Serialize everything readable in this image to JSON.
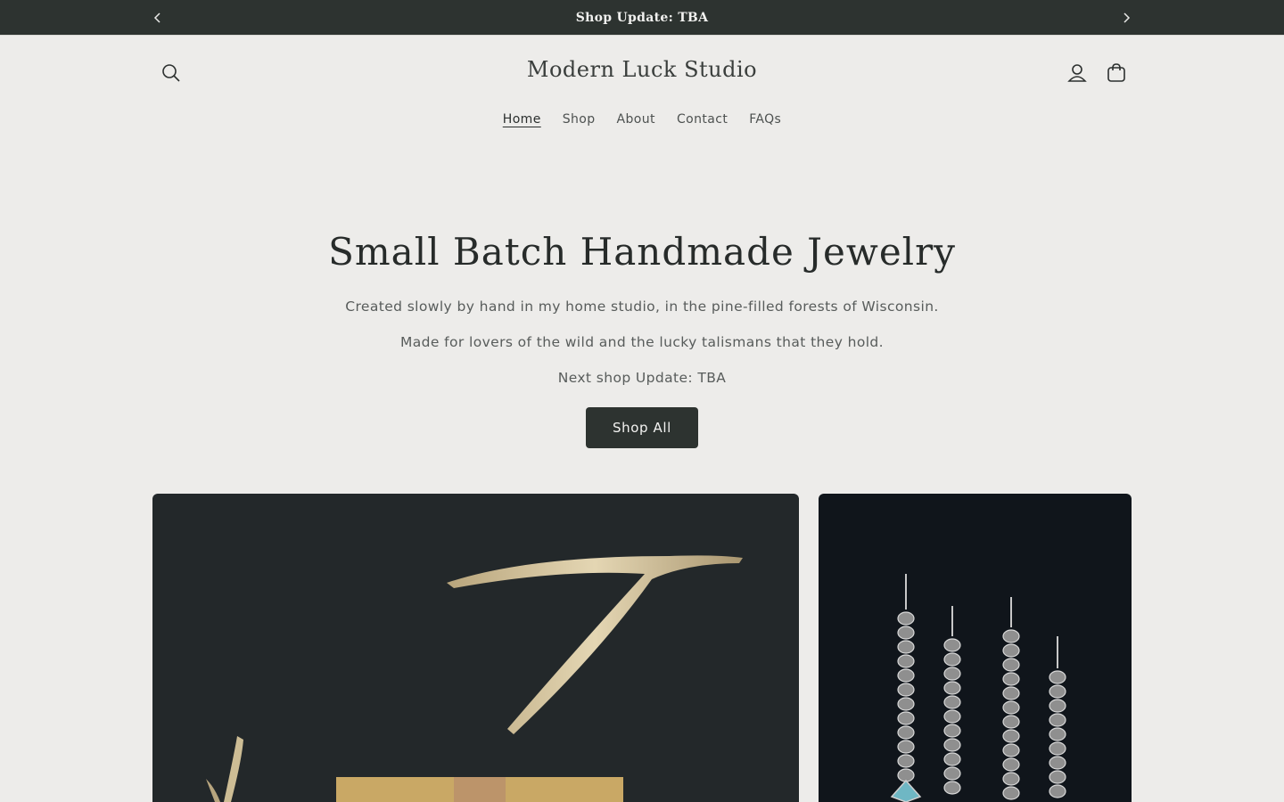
{
  "announcement": {
    "message": "Shop Update: TBA"
  },
  "header": {
    "logo": "Modern Luck Studio",
    "nav": [
      "Home",
      "Shop",
      "About",
      "Contact",
      "FAQs"
    ],
    "active_nav": "Home"
  },
  "hero": {
    "title": "Small Batch Handmade Jewelry",
    "line1": "Created slowly by hand in my home studio, in the pine-filled forests of Wisconsin.",
    "line2": "Made for lovers of the wild and the lucky talismans that they hold.",
    "line3": "Next shop Update: TBA",
    "button": "Shop All"
  },
  "colors": {
    "background": "#edecea",
    "dark": "#2d3330",
    "text": "#2b2f2e"
  },
  "icons": [
    "chevron-left-icon",
    "chevron-right-icon",
    "search-icon",
    "account-icon",
    "cart-icon"
  ]
}
